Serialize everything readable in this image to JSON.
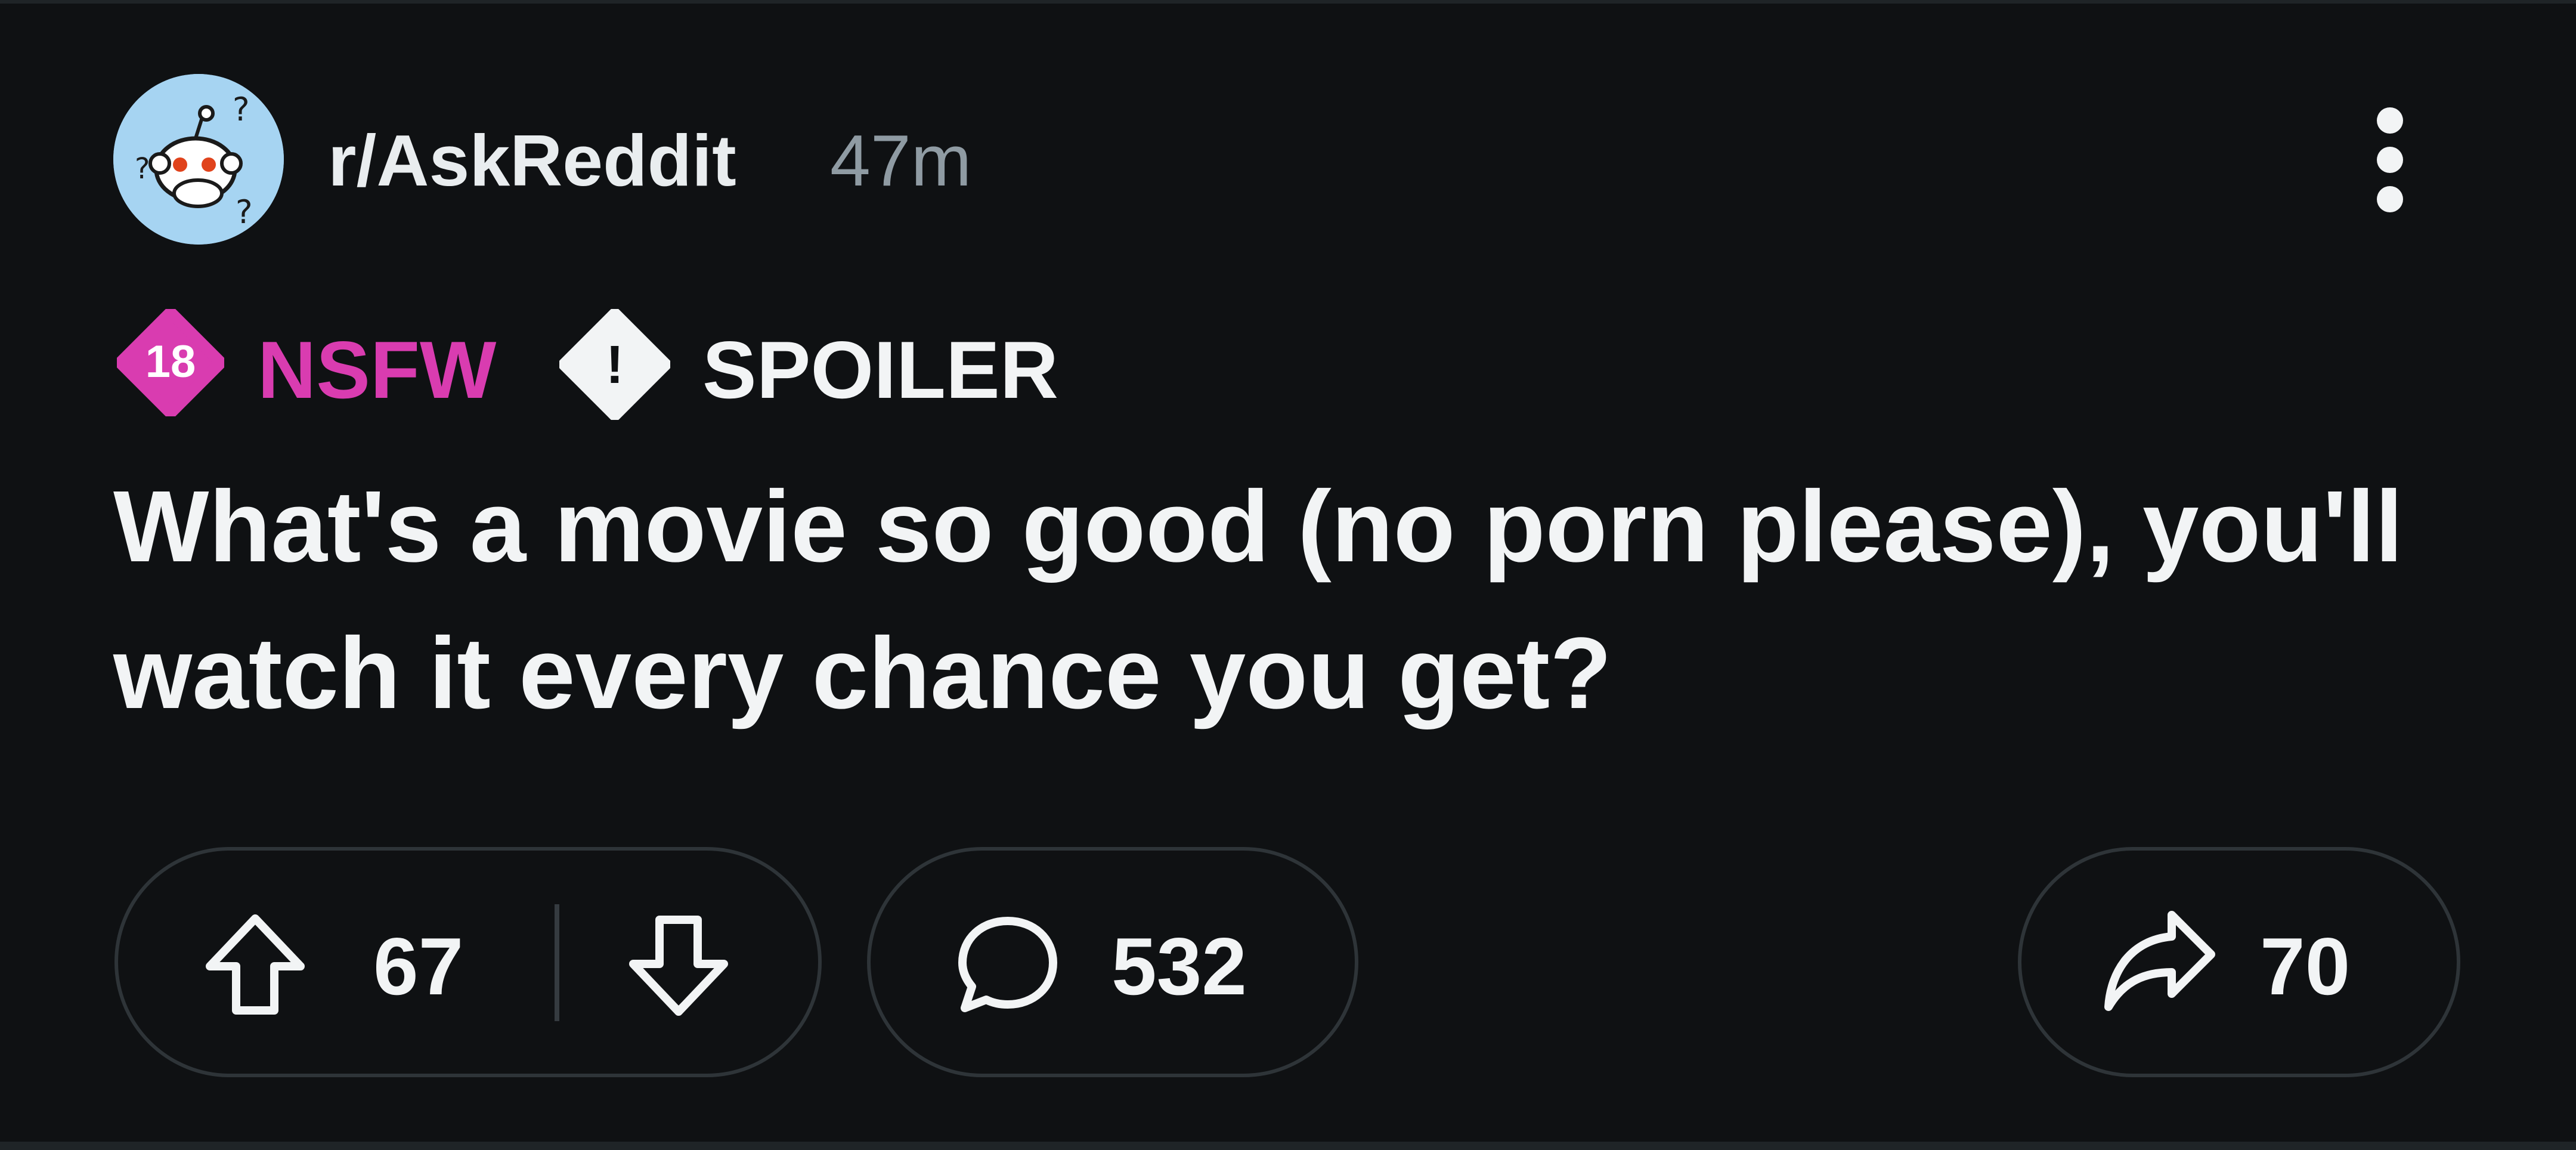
{
  "post": {
    "subreddit": "r/AskReddit",
    "age": "47m",
    "flairs": {
      "nsfw_badge_number": "18",
      "nsfw_label": "NSFW",
      "spoiler_icon_glyph": "!",
      "spoiler_label": "SPOILER"
    },
    "title": "What's a movie so good (no porn please), you'll watch it every chance you get?"
  },
  "actions": {
    "upvotes": "67",
    "comments": "532",
    "shares": "70"
  },
  "colors": {
    "background": "#0f1113",
    "nsfw": "#d93cb0",
    "avatar_bg": "#a6d4f2",
    "pill_border": "#2e3438",
    "muted_text": "#8f9ba3"
  },
  "icons": {
    "avatar": "askreddit-snoo-avatar",
    "more": "vertical-ellipsis-icon",
    "nsfw": "nsfw-18-icon",
    "spoiler": "spoiler-diamond-icon",
    "upvote": "arrow-up-icon",
    "downvote": "arrow-down-icon",
    "comment": "speech-bubble-icon",
    "share": "share-arrow-icon"
  }
}
